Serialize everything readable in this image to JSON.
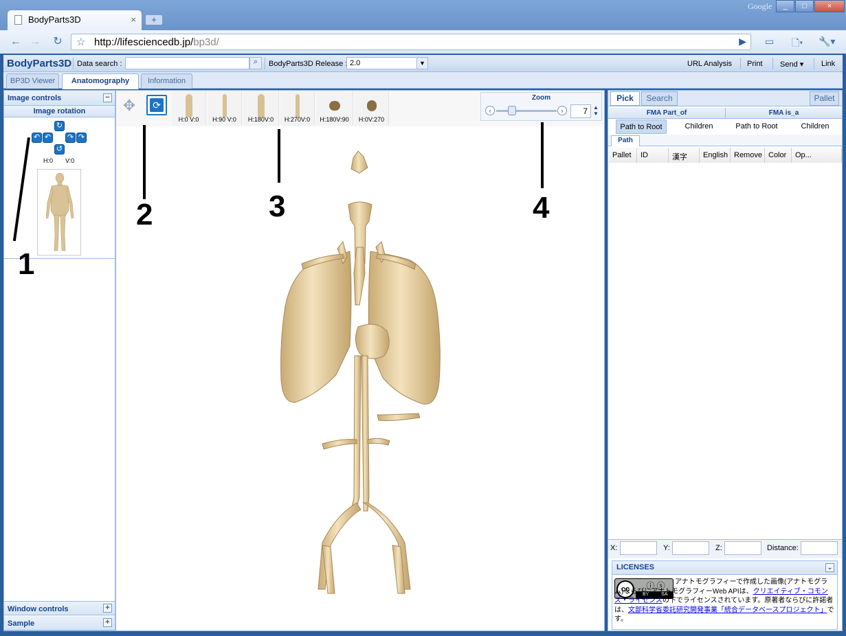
{
  "browser": {
    "tab_title": "BodyParts3D",
    "new_tab": "+",
    "close": "×",
    "brand": "Google",
    "url_host": "http://lifesciencedb.jp/",
    "url_path": "bp3d/",
    "win_buttons": [
      "_",
      "□",
      "×"
    ]
  },
  "appbar": {
    "brand": "BodyParts3D",
    "search_label": "Data search :",
    "search_value": "",
    "release_label": "BodyParts3D Release :",
    "release_value": "2.0",
    "menu": [
      "URL Analysis",
      "Print",
      "Send ▾",
      "Link"
    ]
  },
  "tabs": [
    "BP3D Viewer",
    "Anatomography",
    "Information"
  ],
  "left": {
    "image_controls": "Image controls",
    "image_rotation": "Image rotation",
    "h": "H:0",
    "v": "V:0",
    "window_controls": "Window controls",
    "sample": "Sample"
  },
  "views": [
    "H:0 V:0",
    "H:90 V:0",
    "H:180V:0",
    "H:270V:0",
    "H:180V:90",
    "H:0V:270"
  ],
  "zoom": {
    "label": "Zoom",
    "value": "7",
    "level": 0.26
  },
  "annotations": [
    "1",
    "2",
    "3",
    "4"
  ],
  "right": {
    "tabs": [
      "Pick",
      "Search"
    ],
    "pallet_btn": "Pallet",
    "fma_part_of": "FMA Part_of",
    "fma_is_a": "FMA is_a",
    "buttons": [
      "Path to Root",
      "Children",
      "Path to Root",
      "Children"
    ],
    "path_tab": "Path",
    "columns": [
      "Pallet",
      "ID",
      "漢字",
      "English",
      "Remove",
      "Color",
      "Op..."
    ],
    "coords": [
      "X:",
      "Y:",
      "Z:",
      "Distance:"
    ],
    "licenses": "LICENSES",
    "license_text_1": "アナトモグラフィーで作成した画像(アナトモグラム)ならびにアナトモグラフィーWeb APIは、",
    "license_link_1": "クリエイティブ・コモンズ・ライセンス",
    "license_text_2": "の下でライセンスされています。原著者ならびに許諾者は、",
    "license_link_2": "文部科学省委託研究開発事業「統合データベースプロジェクト」",
    "license_text_3": "です。",
    "cc_by": "BY",
    "cc_sa": "SA"
  }
}
